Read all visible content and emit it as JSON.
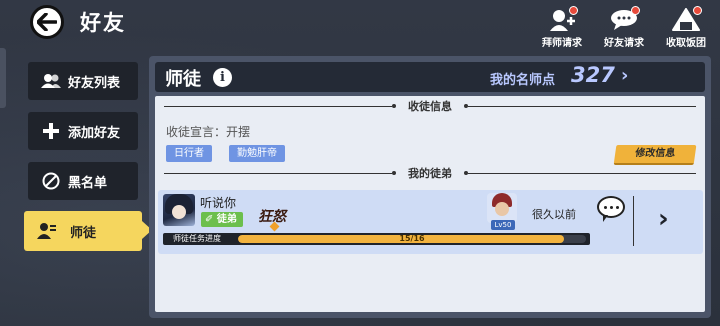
{
  "header": {
    "title": "好友",
    "actions": [
      {
        "label": "拜师请求",
        "icon": "master-request-icon"
      },
      {
        "label": "好友请求",
        "icon": "friend-request-icon"
      },
      {
        "label": "收取饭团",
        "icon": "rice-ball-icon"
      }
    ]
  },
  "sidebar": {
    "items": [
      {
        "label": "好友列表",
        "icon": "friends-list-icon",
        "active": false
      },
      {
        "label": "添加好友",
        "icon": "plus-icon",
        "active": false
      },
      {
        "label": "黑名单",
        "icon": "block-icon",
        "active": false
      },
      {
        "label": "师徒",
        "icon": "mentorship-icon",
        "active": true
      }
    ]
  },
  "panel": {
    "title": "师徒",
    "points_label": "我的名师点",
    "points_value": "327",
    "recruit_section_title": "收徒信息",
    "declaration_label": "收徒宣言：开摆",
    "tags": [
      "日行者",
      "勤勉肝帝"
    ],
    "edit_button": "修改信息",
    "disciples_section_title": "我的徒弟",
    "disciple": {
      "name": "听说你",
      "role_badge": "徒弟",
      "emblem": "狂怒",
      "level_badge": "Lv50",
      "last_seen": "很久以前",
      "progress_label": "师徒任务进度",
      "progress_text": "15/16",
      "progress_fraction": 0.9375
    }
  },
  "colors": {
    "accent_yellow": "#f5d65e",
    "tag_blue": "#6f94e3",
    "badge_green": "#6cbf4c",
    "button_orange": "#f0b23a",
    "progress_orange": "#f2b33f"
  }
}
